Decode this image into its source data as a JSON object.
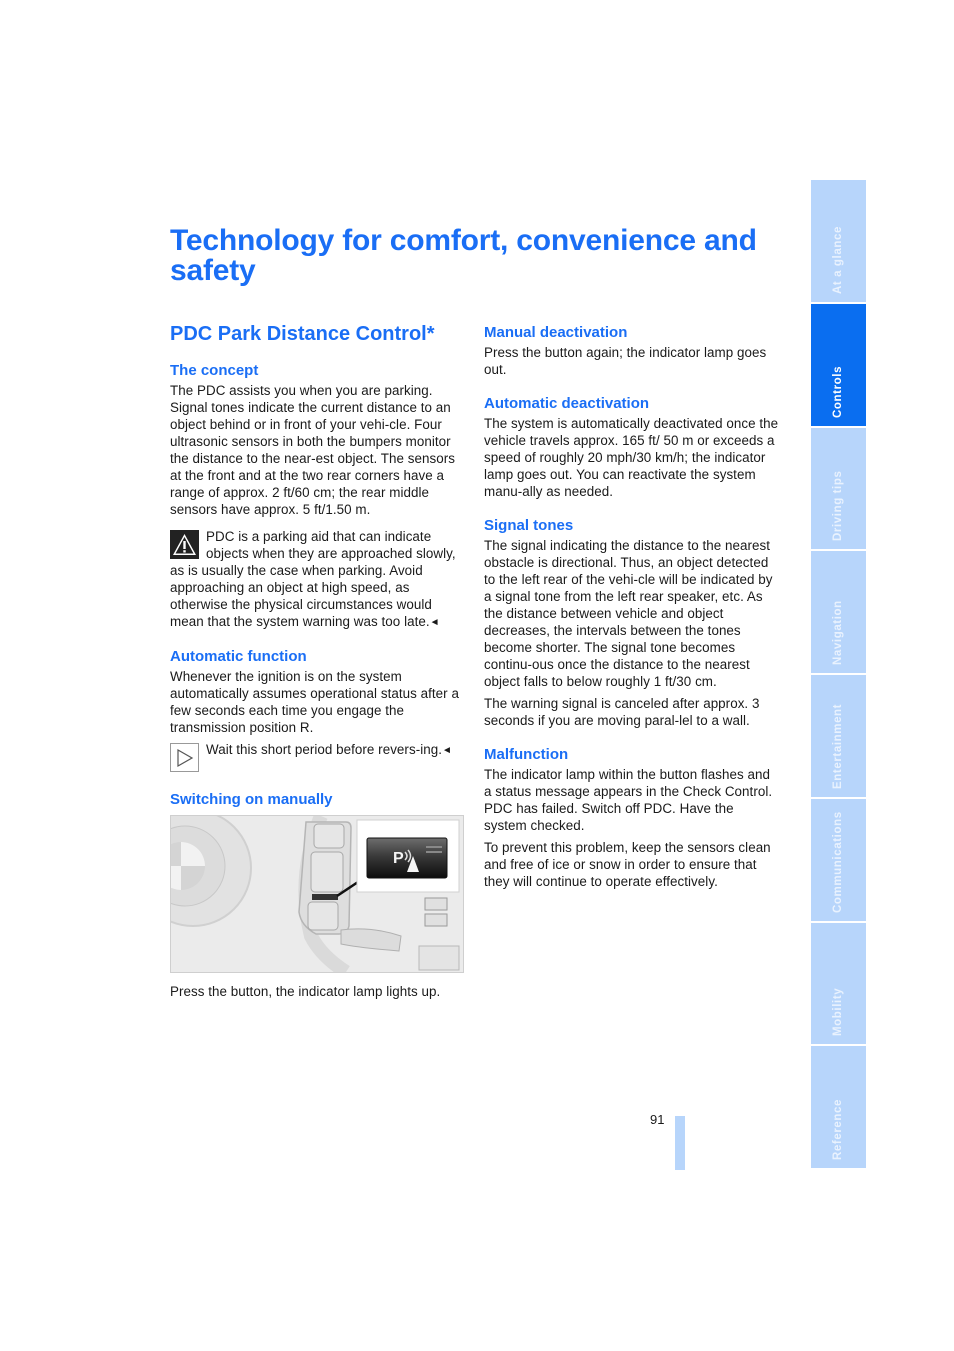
{
  "page": {
    "title": "Technology for comfort, convenience and safety",
    "section_title": "PDC Park Distance Control*",
    "page_number": "91",
    "accent_color": "#1a6ef5"
  },
  "sidebar": {
    "active_index": 1,
    "items": [
      {
        "label": "At a glance"
      },
      {
        "label": "Controls"
      },
      {
        "label": "Driving tips"
      },
      {
        "label": "Navigation"
      },
      {
        "label": "Entertainment"
      },
      {
        "label": "Communications"
      },
      {
        "label": "Mobility"
      },
      {
        "label": "Reference"
      }
    ]
  },
  "left_column": {
    "concept": {
      "heading": "The concept",
      "text": "The PDC assists you when you are parking. Signal tones indicate the current distance to an object behind or in front of your vehi-cle. Four ultrasonic sensors in both the bumpers monitor the distance to the near-est object. The sensors at the front and at the two rear corners have a range of approx. 2 ft/60 cm; the rear middle sensors have approx. 5 ft/1.50 m."
    },
    "warning": {
      "icon": "warning-triangle-icon",
      "text": "PDC is a parking aid that can indicate objects when they are approached slowly, as is usually the case when parking. Avoid approaching an object at high speed, as otherwise the physical circumstances would mean that the system warning was too late.",
      "end_mark": "◄"
    },
    "automatic_function": {
      "heading": "Automatic function",
      "text": "Whenever the ignition is on the system automatically assumes operational status after a few seconds each time you engage the transmission position R."
    },
    "tip": {
      "icon": "play-arrow-icon",
      "text": "Wait this short period before revers-ing.",
      "end_mark": "◄"
    },
    "switching_on": {
      "heading": "Switching on manually",
      "figure_label": "P",
      "caption": "Press the button, the indicator lamp lights up."
    }
  },
  "right_column": {
    "manual_deactivation": {
      "heading": "Manual deactivation",
      "text": "Press the button again; the indicator lamp goes out."
    },
    "automatic_deactivation": {
      "heading": "Automatic deactivation",
      "text": "The system is automatically deactivated once the vehicle travels approx. 165 ft/ 50 m or exceeds a speed of roughly 20 mph/30 km/h; the indicator lamp goes out. You can reactivate the system manu-ally as needed."
    },
    "signal_tones": {
      "heading": "Signal tones",
      "text1": "The signal indicating the distance to the nearest obstacle is directional. Thus, an object detected to the left rear of the vehi-cle will be indicated by a signal tone from the left rear speaker, etc. As the distance between vehicle and object decreases, the intervals between the tones become shorter. The signal tone becomes continu-ous once the distance to the nearest object falls to below roughly 1 ft/30 cm.",
      "text2": "The warning signal is canceled after approx. 3 seconds if you are moving paral-lel to a wall."
    },
    "malfunction": {
      "heading": "Malfunction",
      "text1": "The indicator lamp within the button flashes and a status message appears in the Check Control. PDC has failed. Switch off PDC. Have the system checked.",
      "text2": "To prevent this problem, keep the sensors clean and free of ice or snow in order to ensure that they will continue to operate effectively."
    }
  }
}
